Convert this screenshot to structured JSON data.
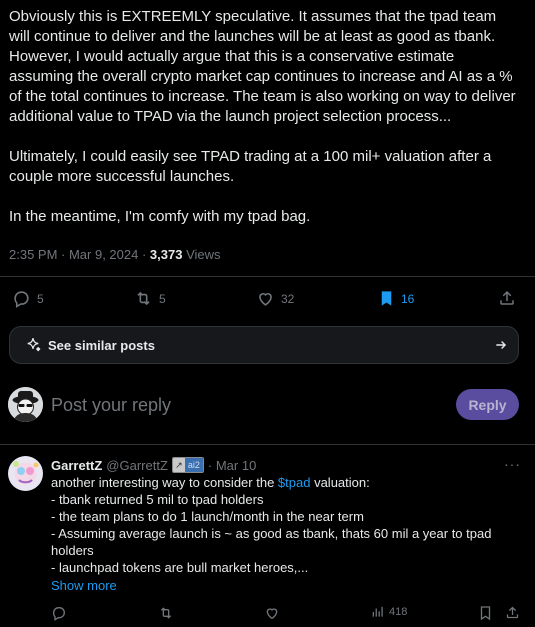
{
  "post": {
    "paragraphs": [
      "Obviously this is EXTREEMLY speculative.  It assumes that the tpad team will continue to deliver and the launches will be at least as good as tbank.  However, I would actually argue that this is a conservative estimate assuming the overall crypto market cap continues to increase and AI as a % of the total continues to increase.  The team is also working on way to deliver additional value to TPAD via the launch project selection process...",
      "Ultimately, I could easily see TPAD trading at a 100 mil+ valuation after a couple more successful launches.",
      "In the meantime, I'm comfy with my tpad bag."
    ],
    "timestamp": "2:35 PM · Mar 9, 2024 · ",
    "views_count": "3,373",
    "views_label": " Views"
  },
  "actions": {
    "replies": "5",
    "reposts": "5",
    "likes": "32",
    "bookmarks": "16"
  },
  "similar": {
    "label": "See similar posts"
  },
  "composer": {
    "placeholder": "Post your reply",
    "button": "Reply"
  },
  "reply": {
    "name": "GarrettZ",
    "handle": "@GarrettZ",
    "badge_text": "ai2",
    "date": "· Mar 10",
    "line1_pre": "another interesting way to consider the ",
    "line1_cash": "$tpad",
    "line1_post": " valuation:",
    "lines": [
      "- tbank returned 5 mil to tpad holders",
      "- the team plans to do 1 launch/month in the near term",
      "- Assuming average launch is ~ as good as tbank, thats 60 mil a year to tpad holders",
      "- launchpad tokens are bull market heroes,..."
    ],
    "show_more": "Show more",
    "views": "418"
  },
  "colors": {
    "accent": "#1d9bf0",
    "muted": "#71767b",
    "text": "#e7e9ea",
    "reply_button": "#5a4c9f"
  },
  "icons": [
    "reply-icon",
    "repost-icon",
    "like-icon",
    "bookmark-icon",
    "share-icon",
    "sparkle-icon",
    "arrow-right-icon",
    "views-icon",
    "more-icon"
  ]
}
